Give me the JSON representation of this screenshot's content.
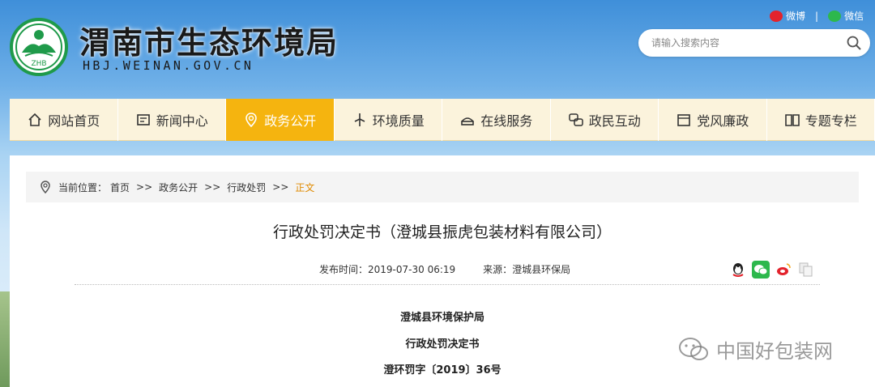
{
  "header": {
    "site_title": "渭南市生态环境局",
    "site_domain": "HBJ.WEINAN.GOV.CN",
    "logo_text": "ZHB",
    "social": {
      "weibo": "微博",
      "separator": "|",
      "wechat": "微信"
    },
    "search": {
      "placeholder": "请输入搜索内容"
    }
  },
  "nav": {
    "items": [
      {
        "label": "网站首页",
        "icon": "home-icon"
      },
      {
        "label": "新闻中心",
        "icon": "news-icon"
      },
      {
        "label": "政务公开",
        "icon": "location-icon",
        "active": true
      },
      {
        "label": "环境质量",
        "icon": "windmill-icon"
      },
      {
        "label": "在线服务",
        "icon": "service-icon"
      },
      {
        "label": "政民互动",
        "icon": "interaction-icon"
      },
      {
        "label": "党风廉政",
        "icon": "party-icon"
      },
      {
        "label": "专题专栏",
        "icon": "book-icon"
      }
    ]
  },
  "breadcrumb": {
    "label": "当前位置：",
    "items": [
      "首页",
      "政务公开",
      "行政处罚"
    ],
    "separator": ">>",
    "current": "正文"
  },
  "article": {
    "title": "行政处罚决定书（澄城县振虎包装材料有限公司）",
    "publish_label": "发布时间：",
    "publish_time": "2019-07-30 06:19",
    "source_label": "来源：",
    "source": "澄城县环保局",
    "body": {
      "line1": "澄城县环境保护局",
      "line2": "行政处罚决定书",
      "line3": "澄环罚字〔2019〕36号"
    }
  },
  "share": [
    "qq-icon",
    "wechat-icon",
    "weibo-icon",
    "copy-icon"
  ],
  "watermark": {
    "text": "中国好包装网"
  },
  "colors": {
    "nav_active": "#f5b40f",
    "nav_bg": "#fbf3dc",
    "logo_green": "#1f9a4a",
    "current_crumb": "#e08a00"
  }
}
